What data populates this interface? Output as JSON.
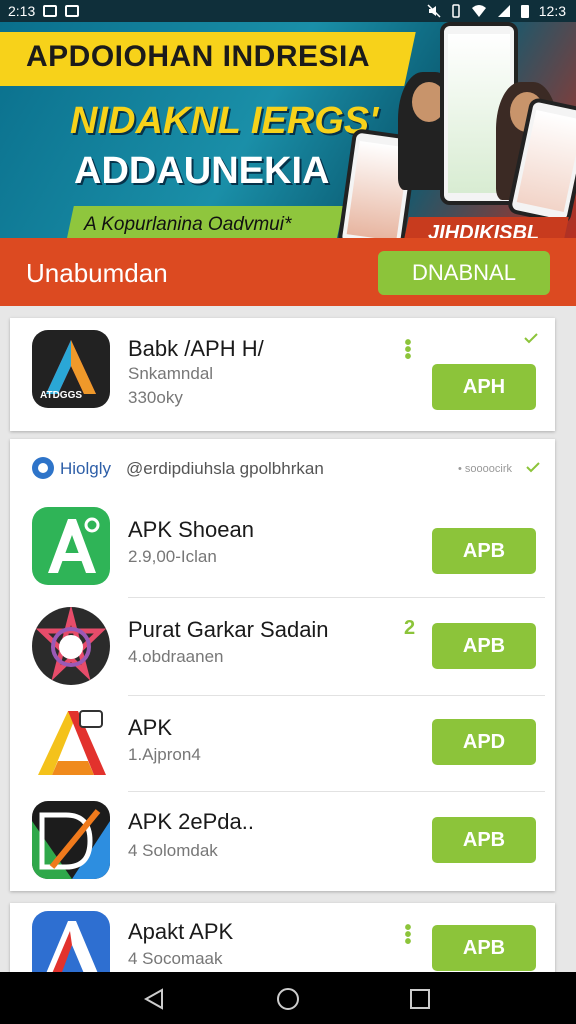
{
  "status_bar": {
    "time_left": "2:13",
    "time_right": "12:3"
  },
  "banner": {
    "title1": "APDOIOHAN INDRESIA",
    "title2": "NIDAKNL IERGS'",
    "title3": "ADDAUNEKIA",
    "tagline": "A Kopurlanina Oadvmui*",
    "red_tag": "JIHDIKISBL"
  },
  "header": {
    "label": "Unabumdan",
    "download_button": "DNABNAL"
  },
  "featured_app": {
    "name": "Babk /APH H/",
    "sub1": "Snkamndal",
    "sub2": "330oky",
    "icon_text": "ATDGGS",
    "button": "APH"
  },
  "list_section": {
    "brand": "Hiolgly",
    "handle": "@erdipdiuhsla gpolbhrkan",
    "right_text": "• soooocirk",
    "apps": [
      {
        "name": "APK Shoean",
        "sub": "2.9,00-Iclan",
        "button": "APB"
      },
      {
        "name": "Purat Garkar Sadain",
        "sub": "4.obdraanen",
        "badge": "2",
        "button": "APB"
      },
      {
        "name": "APK",
        "sub": "1.Ajpron4",
        "button": "APD"
      },
      {
        "name": "APK 2ePda..",
        "sub": "4 Solomdak",
        "button": "APB"
      }
    ]
  },
  "bottom_app": {
    "name": "Apakt APK",
    "sub": "4 Socomaak",
    "button": "APB"
  },
  "colors": {
    "accent_green": "#8cc43a",
    "header_orange": "#dc4a21",
    "banner_yellow": "#f7d21a"
  }
}
